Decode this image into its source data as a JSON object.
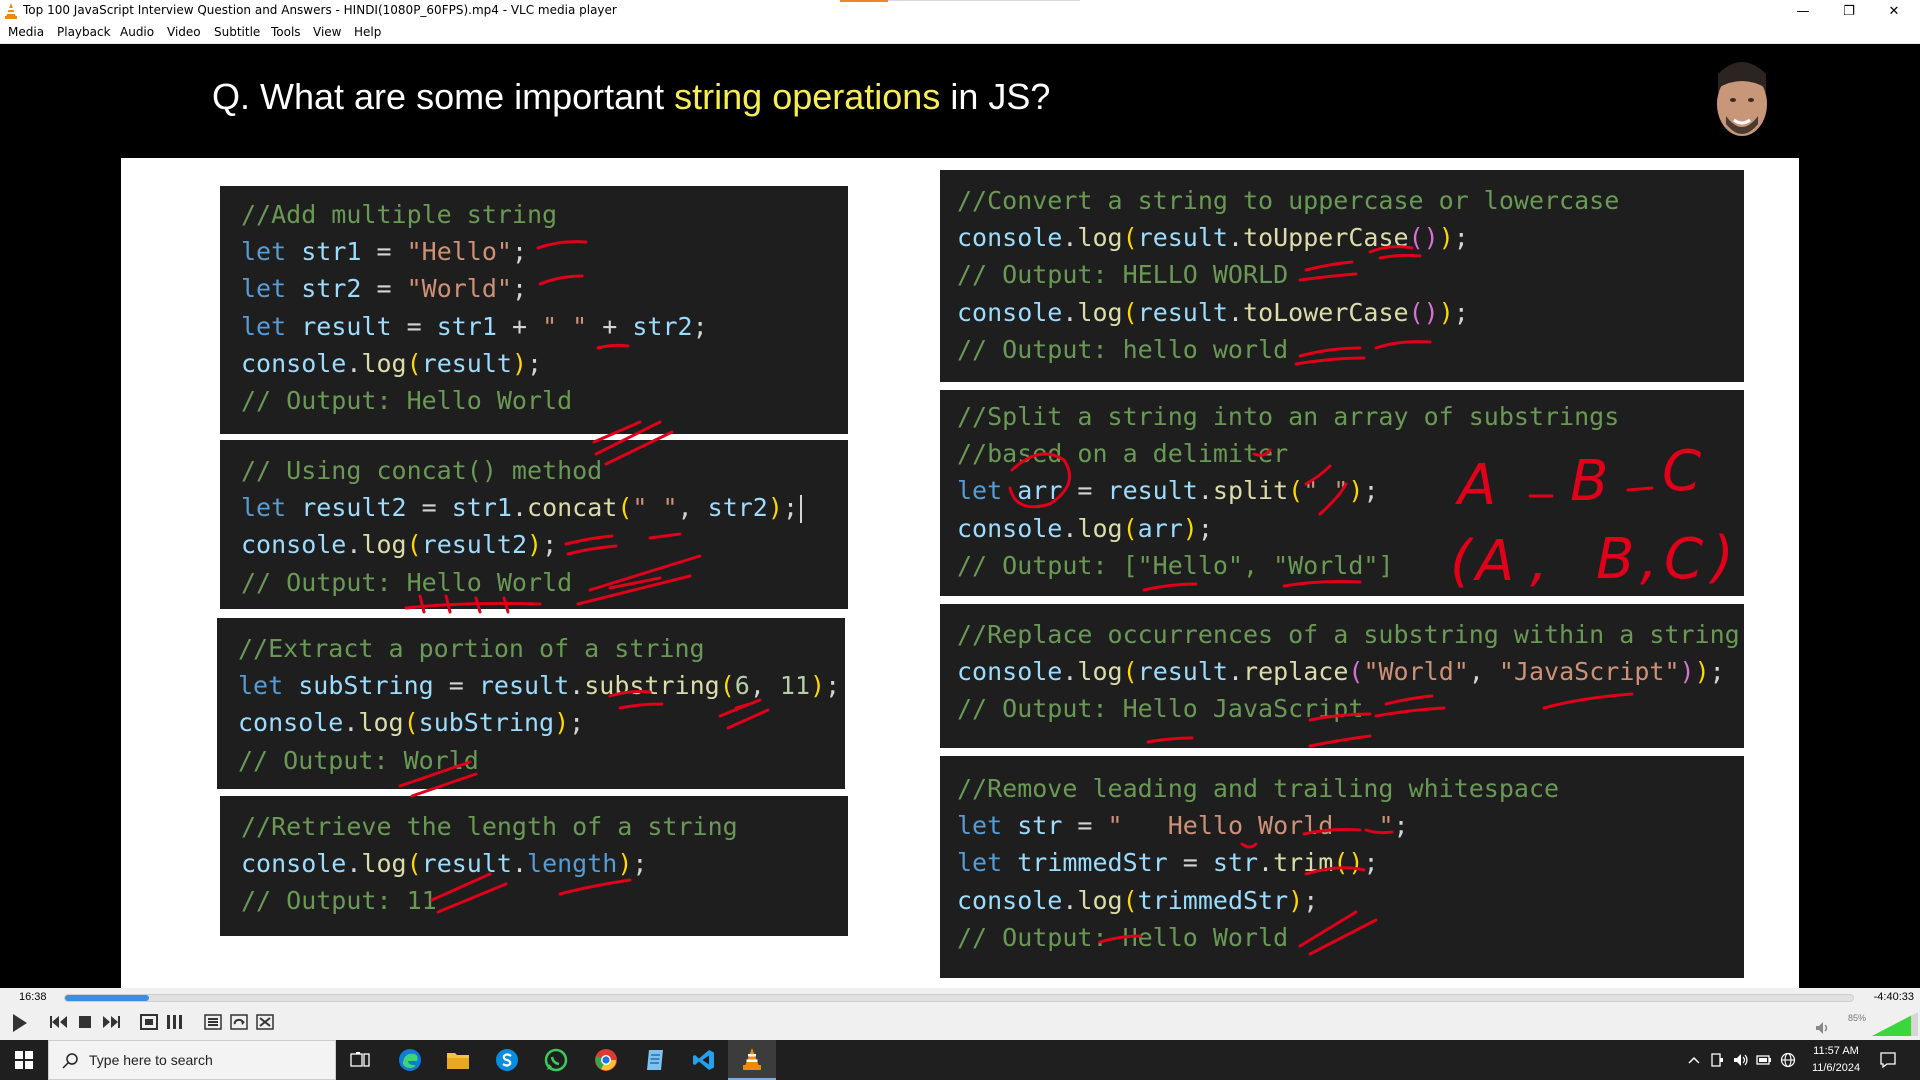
{
  "window": {
    "title": "Top 100 JavaScript Interview Question and Answers - HINDI(1080P_60FPS).mp4 - VLC media player",
    "minimize": "—",
    "restore": "❐",
    "close": "✕"
  },
  "menu": [
    "Media",
    "Playback",
    "Audio",
    "Video",
    "Subtitle",
    "Tools",
    "View",
    "Help"
  ],
  "slide": {
    "title_prefix": "Q. What are some important ",
    "title_highlight": "string operations",
    "title_suffix": " in JS?",
    "colors": {
      "code_bg": "#1e1e1e",
      "comment": "#6a9955",
      "keyword": "#569cd6",
      "string": "#ce9178",
      "function": "#dcdcaa",
      "variable": "#9cdcfe",
      "annotation": "#e0001a"
    }
  },
  "code_boxes": [
    {
      "id": "add-string",
      "lines": [
        [
          [
            "com",
            "//Add multiple string"
          ]
        ],
        [
          [
            "kw",
            "let "
          ],
          [
            "var",
            "str1"
          ],
          [
            "p",
            " = "
          ],
          [
            "str",
            "\"Hello\""
          ],
          [
            "p",
            ";"
          ]
        ],
        [
          [
            "kw",
            "let "
          ],
          [
            "var",
            "str2"
          ],
          [
            "p",
            " = "
          ],
          [
            "str",
            "\"World\""
          ],
          [
            "p",
            ";"
          ]
        ],
        [
          [
            "kw",
            "let "
          ],
          [
            "var",
            "result"
          ],
          [
            "p",
            " = "
          ],
          [
            "var",
            "str1"
          ],
          [
            "p",
            " + "
          ],
          [
            "str",
            "\" \""
          ],
          [
            "p",
            " + "
          ],
          [
            "var",
            "str2"
          ],
          [
            "p",
            ";"
          ]
        ],
        [
          [
            "var",
            "console"
          ],
          [
            "p",
            "."
          ],
          [
            "fn",
            "log"
          ],
          [
            "br",
            "("
          ],
          [
            "var",
            "result"
          ],
          [
            "br",
            ")"
          ],
          [
            "p",
            ";"
          ]
        ],
        [
          [
            "com",
            "// Output: Hello World"
          ]
        ]
      ]
    },
    {
      "id": "concat",
      "lines": [
        [
          [
            "com",
            "// Using concat() method"
          ]
        ],
        [
          [
            "kw",
            "let "
          ],
          [
            "var",
            "result2"
          ],
          [
            "p",
            " = "
          ],
          [
            "var",
            "str1"
          ],
          [
            "p",
            "."
          ],
          [
            "fn",
            "concat"
          ],
          [
            "br",
            "("
          ],
          [
            "str",
            "\" \""
          ],
          [
            "p",
            ", "
          ],
          [
            "var",
            "str2"
          ],
          [
            "br",
            ")"
          ],
          [
            "p",
            ";"
          ],
          [
            "cursor",
            ""
          ]
        ],
        [
          [
            "var",
            "console"
          ],
          [
            "p",
            "."
          ],
          [
            "fn",
            "log"
          ],
          [
            "br",
            "("
          ],
          [
            "var",
            "result2"
          ],
          [
            "br",
            ")"
          ],
          [
            "p",
            ";"
          ]
        ],
        [
          [
            "com",
            "// Output: Hello World"
          ]
        ]
      ]
    },
    {
      "id": "substring",
      "lines": [
        [
          [
            "com",
            "//Extract a portion of a string"
          ]
        ],
        [
          [
            "kw",
            "let "
          ],
          [
            "var",
            "subString"
          ],
          [
            "p",
            " = "
          ],
          [
            "var",
            "result"
          ],
          [
            "p",
            "."
          ],
          [
            "fn",
            "substring"
          ],
          [
            "br",
            "("
          ],
          [
            "num",
            "6"
          ],
          [
            "p",
            ", "
          ],
          [
            "num",
            "11"
          ],
          [
            "br",
            ")"
          ],
          [
            "p",
            ";"
          ]
        ],
        [
          [
            "var",
            "console"
          ],
          [
            "p",
            "."
          ],
          [
            "fn",
            "log"
          ],
          [
            "br",
            "("
          ],
          [
            "var",
            "subString"
          ],
          [
            "br",
            ")"
          ],
          [
            "p",
            ";"
          ]
        ],
        [
          [
            "com",
            "// Output: World"
          ]
        ]
      ]
    },
    {
      "id": "length",
      "lines": [
        [
          [
            "com",
            "//Retrieve the length of a string"
          ]
        ],
        [
          [
            "var",
            "console"
          ],
          [
            "p",
            "."
          ],
          [
            "fn",
            "log"
          ],
          [
            "br",
            "("
          ],
          [
            "var",
            "result"
          ],
          [
            "p",
            "."
          ],
          [
            "kw",
            "length"
          ],
          [
            "br",
            ")"
          ],
          [
            "p",
            ";"
          ]
        ],
        [
          [
            "com",
            "// Output: 11"
          ]
        ]
      ]
    },
    {
      "id": "case",
      "lines": [
        [
          [
            "com",
            "//Convert a string to uppercase or lowercase"
          ]
        ],
        [
          [
            "var",
            "console"
          ],
          [
            "p",
            "."
          ],
          [
            "fn",
            "log"
          ],
          [
            "br",
            "("
          ],
          [
            "var",
            "result"
          ],
          [
            "p",
            "."
          ],
          [
            "fn",
            "toUpperCase"
          ],
          [
            "br2",
            "()"
          ],
          [
            "br",
            ")"
          ],
          [
            "p",
            ";"
          ]
        ],
        [
          [
            "com",
            "// Output: HELLO WORLD"
          ]
        ],
        [
          [
            "var",
            "console"
          ],
          [
            "p",
            "."
          ],
          [
            "fn",
            "log"
          ],
          [
            "br",
            "("
          ],
          [
            "var",
            "result"
          ],
          [
            "p",
            "."
          ],
          [
            "fn",
            "toLowerCase"
          ],
          [
            "br2",
            "()"
          ],
          [
            "br",
            ")"
          ],
          [
            "p",
            ";"
          ]
        ],
        [
          [
            "com",
            "// Output: hello world"
          ]
        ]
      ]
    },
    {
      "id": "split",
      "lines": [
        [
          [
            "com",
            "//Split a string into an array of substrings"
          ]
        ],
        [
          [
            "com",
            "//based on a delimiter"
          ]
        ],
        [
          [
            "kw",
            "let "
          ],
          [
            "var",
            "arr"
          ],
          [
            "p",
            " = "
          ],
          [
            "var",
            "result"
          ],
          [
            "p",
            "."
          ],
          [
            "fn",
            "split"
          ],
          [
            "br",
            "("
          ],
          [
            "str",
            "\" \""
          ],
          [
            "br",
            ")"
          ],
          [
            "p",
            ";"
          ]
        ],
        [
          [
            "var",
            "console"
          ],
          [
            "p",
            "."
          ],
          [
            "fn",
            "log"
          ],
          [
            "br",
            "("
          ],
          [
            "var",
            "arr"
          ],
          [
            "br",
            ")"
          ],
          [
            "p",
            ";"
          ]
        ],
        [
          [
            "com",
            "// Output: [\"Hello\", \"World\"]"
          ]
        ]
      ]
    },
    {
      "id": "replace",
      "lines": [
        [
          [
            "com",
            "//Replace occurrences of a substring within a string"
          ]
        ],
        [
          [
            "var",
            "console"
          ],
          [
            "p",
            "."
          ],
          [
            "fn",
            "log"
          ],
          [
            "br",
            "("
          ],
          [
            "var",
            "result"
          ],
          [
            "p",
            "."
          ],
          [
            "fn",
            "replace"
          ],
          [
            "br2",
            "("
          ],
          [
            "str",
            "\"World\""
          ],
          [
            "p",
            ", "
          ],
          [
            "str",
            "\"JavaScript\""
          ],
          [
            "br2",
            ")"
          ],
          [
            "br",
            ")"
          ],
          [
            "p",
            ";"
          ]
        ],
        [
          [
            "com",
            "// Output: Hello JavaScript"
          ]
        ]
      ]
    },
    {
      "id": "trim",
      "lines": [
        [
          [
            "com",
            "//Remove leading and trailing whitespace"
          ]
        ],
        [
          [
            "kw",
            "let "
          ],
          [
            "var",
            "str"
          ],
          [
            "p",
            " = "
          ],
          [
            "str",
            "\"   Hello World   \""
          ],
          [
            "p",
            ";"
          ]
        ],
        [
          [
            "kw",
            "let "
          ],
          [
            "var",
            "trimmedStr"
          ],
          [
            "p",
            " = "
          ],
          [
            "var",
            "str"
          ],
          [
            "p",
            "."
          ],
          [
            "fn",
            "trim"
          ],
          [
            "br",
            "()"
          ],
          [
            "p",
            ";"
          ]
        ],
        [
          [
            "var",
            "console"
          ],
          [
            "p",
            "."
          ],
          [
            "fn",
            "log"
          ],
          [
            "br",
            "("
          ],
          [
            "var",
            "trimmedStr"
          ],
          [
            "br",
            ")"
          ],
          [
            "p",
            ";"
          ]
        ],
        [
          [
            "com",
            "// Output: Hello World"
          ]
        ]
      ]
    }
  ],
  "annotations": {
    "split_example_top": [
      "A",
      "B",
      "C"
    ],
    "split_example_bottom": [
      "(",
      "A",
      ",",
      "B",
      ",",
      "C",
      ")"
    ]
  },
  "controls": {
    "elapsed": "16:38",
    "remaining": "-4:40:33",
    "progress_fraction": 0.047,
    "volume_percent": "85%",
    "volume_fraction": 0.85,
    "buttons": [
      "play",
      "previous",
      "stop",
      "next",
      "fullscreen",
      "extended-settings",
      "playlist",
      "loop",
      "shuffle"
    ]
  },
  "taskbar": {
    "search_placeholder": "Type here to search",
    "apps": [
      "task-view",
      "edge",
      "file-explorer",
      "skype",
      "whatsapp",
      "chrome",
      "notepad",
      "vscode",
      "vlc"
    ],
    "time": "11:57 AM",
    "date": "11/6/2024"
  }
}
